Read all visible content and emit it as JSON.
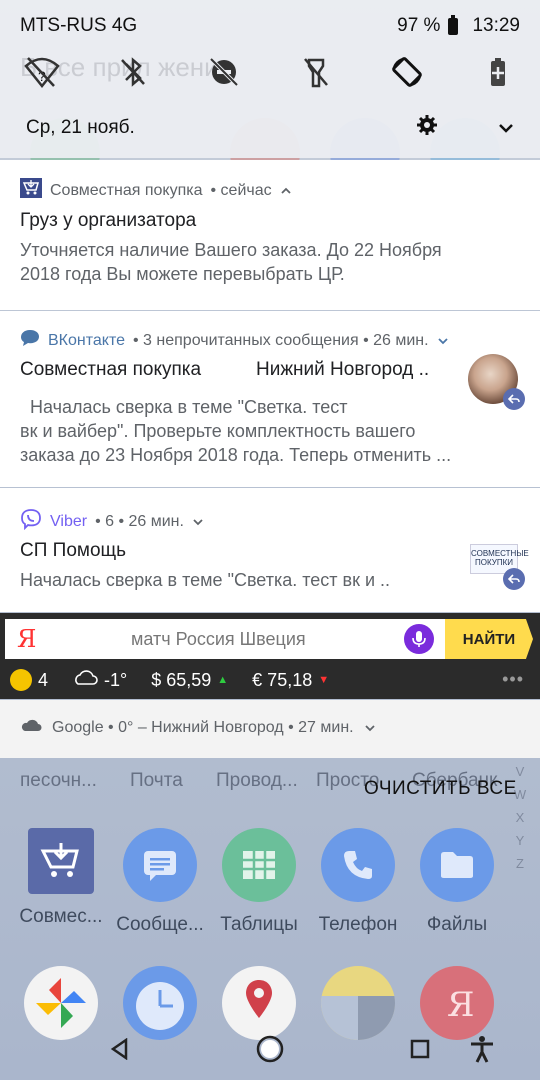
{
  "status_bar": {
    "carrier": "MTS-RUS 4G",
    "battery": "97 %",
    "time": "13:29"
  },
  "quick_settings": {
    "ghost_text": "Б все прил жени",
    "icons": [
      "wifi-off-icon",
      "bluetooth-off-icon",
      "dnd-off-icon",
      "flashlight-off-icon",
      "auto-rotate-icon",
      "battery-saver-icon"
    ],
    "date": "Ср, 21 нояб."
  },
  "notifications": [
    {
      "app": "Совместная покупка",
      "meta": "• сейчас",
      "title": "Груз у организатора",
      "body_lines": [
        "Уточняется наличие Вашего заказа. До 22 Ноября",
        "2018 года Вы можете перевыбрать ЦР."
      ]
    },
    {
      "app": "ВКонтакте",
      "meta": "• 3 непрочитанных сообщения • 26 мин.",
      "title_left": "Совместная покупка",
      "title_right": "Нижний Новгород ..",
      "body_lines": [
        "  Началась сверка в теме \"Светка. тест",
        "вк и вайбер\". Проверьте комплектность вашего",
        "заказа до 23 Ноября 2018 года. Теперь отменить ..."
      ]
    },
    {
      "app": "Viber",
      "meta": "• 6 • 26 мин.",
      "title": "СП Помощь",
      "body_lines": [
        "Началась сверка в теме \"Светка. тест вк и .."
      ],
      "thumb_text": "СОВМЕСТНЫЕ ПОКУПКИ"
    }
  ],
  "yandex": {
    "logo": "Я",
    "query": "матч Россия Швеция",
    "find_label": "НАЙТИ",
    "traffic": "4",
    "weather": "-1°",
    "usd": "$ 65,59",
    "eur": "€ 75,18",
    "more": "•••"
  },
  "google_weather": {
    "text": "Google • 0° – Нижний Новгород • 27 мин."
  },
  "home": {
    "top_labels": [
      "песочн...",
      "Почта",
      "Провод...",
      "Просто",
      "Сбербанк"
    ],
    "alphabet": [
      "V",
      "W",
      "X",
      "Y",
      "Z"
    ],
    "clear_all": "ОЧИСТИТЬ ВСЕ",
    "apps": [
      {
        "label": "Совмес..."
      },
      {
        "label": "Сообще..."
      },
      {
        "label": "Таблицы"
      },
      {
        "label": "Телефон"
      },
      {
        "label": "Файлы"
      }
    ]
  },
  "colors": {
    "vk_blue": "#4a76a8",
    "viber_purple": "#7360f2",
    "yandex_yellow": "#ffdb4d",
    "yandex_mic": "#7a2bdc"
  }
}
